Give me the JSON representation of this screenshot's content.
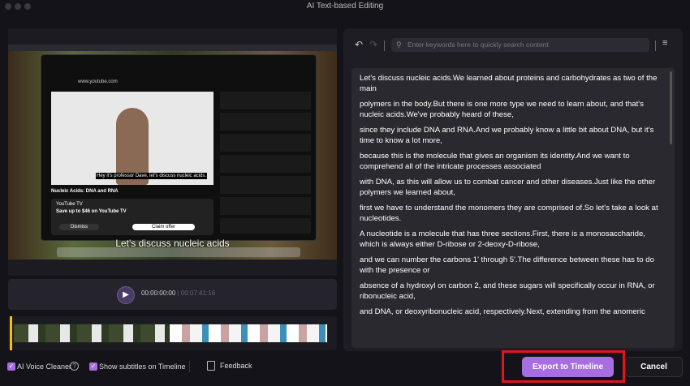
{
  "window": {
    "title": "AI Text-based Editing"
  },
  "video": {
    "subtitle": "Let's discuss nucleic acids",
    "video_title": "Nucleic Acids: DNA and RNA",
    "ad_brand": "YouTube TV",
    "ad_text": "Save up to $46 on YouTube TV",
    "ad_button": "Claim offer",
    "ad_dismiss": "Dismiss",
    "caption": "Hey it's professor Dave, let's discuss nucleic acids.",
    "url": "www.youtube.com"
  },
  "player": {
    "current_time": "00:00:00:00",
    "total_time": "00:07:41:16",
    "play_icon": "play-icon"
  },
  "options": {
    "voice_cleaner": "AI Voice Cleaner",
    "voice_cleaner_checked": true,
    "show_subtitles": "Show subtitles on Timeline",
    "show_subtitles_checked": true,
    "feedback": "Feedback"
  },
  "editor": {
    "search_placeholder": "Enter keywords here to quickly search content",
    "paragraphs": [
      "Let's discuss nucleic acids.We learned about proteins and carbohydrates as two of the main",
      " polymers in the body.But there is one more type we need to learn about, and that's nucleic acids.We've probably heard of these,",
      " since they include DNA and RNA.And we probably know a little bit about DNA, but it's time to know a lot more,",
      " because this is the molecule that gives an organism its identity.And we want to comprehend all of the intricate processes associated",
      " with DNA, as this will allow us to combat cancer and other diseases.Just like the other polymers we learned about,",
      " first we have to understand the monomers they are comprised of.So let's take a look at nucleotides.",
      "A nucleotide is a molecule that has three sections.First, there is a monosaccharide, which is always either D-ribose or 2-deoxy-D-ribose,",
      " and we can number the carbons 1' through 5'.The difference between these has to do with the presence or",
      "absence of a hydroxyl on carbon 2, and these sugars will specifically occur in RNA, or ribonucleic acid,",
      " and DNA, or deoxyribonucleic acid, respectively.Next, extending from the anomeric"
    ]
  },
  "actions": {
    "export": "Export to Timeline",
    "cancel": "Cancel"
  },
  "colors": {
    "accent": "#a66ee0",
    "highlight": "#e0161b",
    "playhead": "#f2c400"
  }
}
